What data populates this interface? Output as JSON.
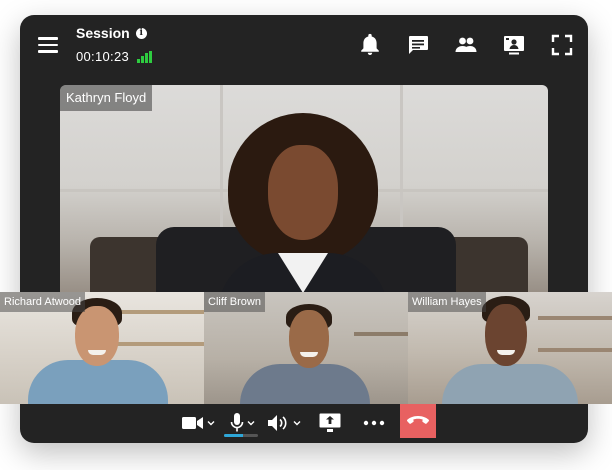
{
  "header": {
    "title": "Session",
    "timer": "00:10:23",
    "icons": [
      "menu-icon",
      "info-icon",
      "signal-icon",
      "bell-icon",
      "chat-icon",
      "participants-icon",
      "screen-share-icon",
      "fullscreen-icon"
    ]
  },
  "main_speaker": {
    "name": "Kathryn Floyd"
  },
  "participants": [
    {
      "name": "Richard Atwood"
    },
    {
      "name": "Cliff Brown"
    },
    {
      "name": "William Hayes"
    }
  ],
  "controls": {
    "icons": [
      "camera-icon",
      "microphone-icon",
      "speaker-icon",
      "share-screen-icon",
      "more-icon",
      "hang-up-icon"
    ],
    "mic_level": 0.55
  },
  "colors": {
    "app_background": "#232323",
    "signal": "#2ecc40",
    "mic_level": "#2ea7d8",
    "hang_up": "#e86161"
  }
}
